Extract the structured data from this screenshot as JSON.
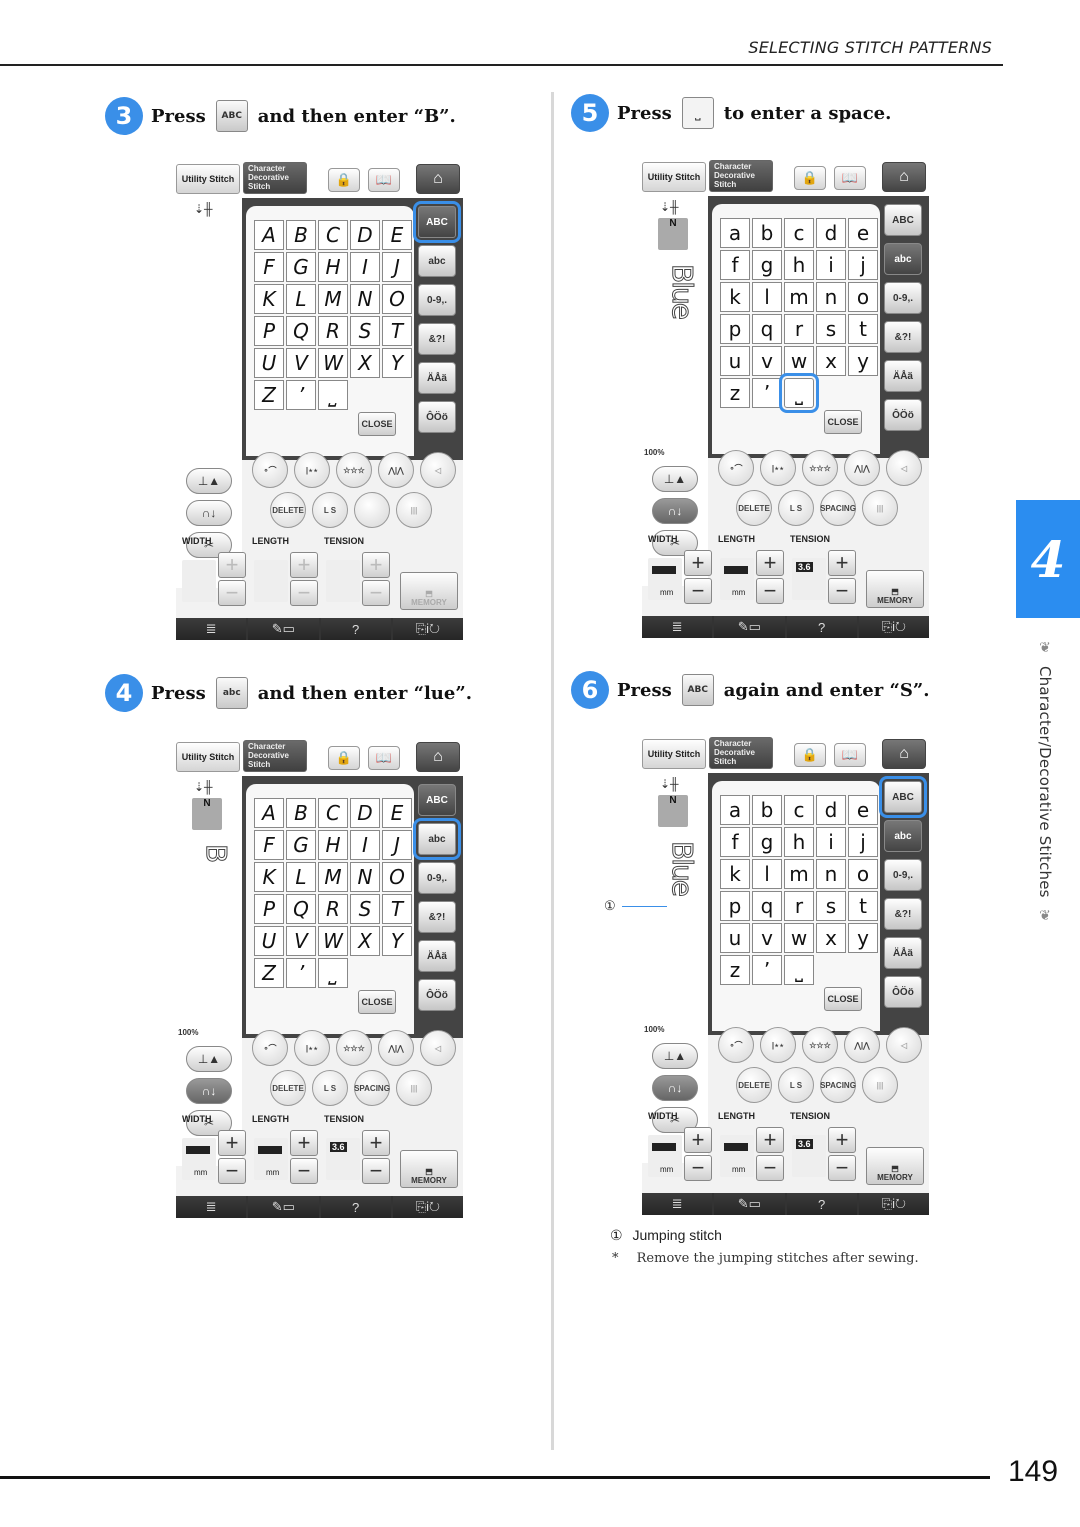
{
  "header": {
    "title": "SELECTING STITCH PATTERNS"
  },
  "page_number": "149",
  "chapter": {
    "number": "4",
    "title": "Character/Decorative Stitches",
    "ornament": "❦"
  },
  "steps": [
    {
      "num": "3",
      "prefix": "Press",
      "key": "ABC",
      "suffix": "and then enter “B”."
    },
    {
      "num": "4",
      "prefix": "Press",
      "key": "abc",
      "suffix": "and then enter “lue”."
    },
    {
      "num": "5",
      "prefix": "Press",
      "key": "⎵",
      "suffix": "to enter a space."
    },
    {
      "num": "6",
      "prefix": "Press",
      "key": "ABC",
      "suffix": "again and enter “S”."
    }
  ],
  "screen_common": {
    "tab_utility": "Utility Stitch",
    "tab_character": "Character Decorative Stitch",
    "lock_icon": "🔒",
    "book_icon": "📖",
    "home_icon": "⌂",
    "side_buttons": [
      "ABC",
      "abc",
      "0-9,.",
      "&?!",
      "ÄÅä",
      "ÔÖö"
    ],
    "close_label": "CLOSE",
    "width_label": "WIDTH",
    "length_label": "LENGTH",
    "tension_label": "TENSION",
    "memory_label": "MEMORY",
    "delete_label": "DELETE",
    "ls_label": "L S",
    "spacing_label": "SPACING",
    "mm_label": "mm",
    "tension_value": "3.6",
    "zoom_label": "100%",
    "bottom_icons": [
      "≣",
      "✎▭",
      "?",
      "⎘i↻"
    ],
    "upper_keys": [
      "A",
      "B",
      "C",
      "D",
      "E",
      "F",
      "G",
      "H",
      "I",
      "J",
      "K",
      "L",
      "M",
      "N",
      "O",
      "P",
      "Q",
      "R",
      "S",
      "T",
      "U",
      "V",
      "W",
      "X",
      "Y",
      "Z",
      "’",
      "⎵"
    ],
    "lower_keys": [
      "a",
      "b",
      "c",
      "d",
      "e",
      "f",
      "g",
      "h",
      "i",
      "j",
      "k",
      "l",
      "m",
      "n",
      "o",
      "p",
      "q",
      "r",
      "s",
      "t",
      "u",
      "v",
      "w",
      "x",
      "y",
      "z",
      "’",
      "⎵"
    ]
  },
  "screens": [
    {
      "id": "step3",
      "case": "upper",
      "active_side": 0,
      "highlight_side": 0,
      "highlight_key": -1,
      "preview": "",
      "show_foot": false,
      "show_zoom": false,
      "controls_enabled": false,
      "spacing_visible": false
    },
    {
      "id": "step4",
      "case": "upper",
      "active_side": 0,
      "highlight_side": 1,
      "highlight_key": -1,
      "preview": "B",
      "show_foot": true,
      "show_zoom": true,
      "controls_enabled": true,
      "spacing_visible": true
    },
    {
      "id": "step5",
      "case": "lower",
      "active_side": 1,
      "highlight_side": -1,
      "highlight_key": 27,
      "preview": "Blue",
      "show_foot": true,
      "show_zoom": true,
      "controls_enabled": true,
      "spacing_visible": true
    },
    {
      "id": "step6",
      "case": "lower",
      "active_side": 1,
      "highlight_side": 0,
      "highlight_key": -1,
      "preview": "Blue ",
      "show_foot": true,
      "show_zoom": true,
      "controls_enabled": true,
      "spacing_visible": true
    }
  ],
  "callout": {
    "marker": "①",
    "label": "Jumping stitch"
  },
  "note": {
    "marker": "*",
    "text": "Remove the jumping stitches after sewing."
  }
}
